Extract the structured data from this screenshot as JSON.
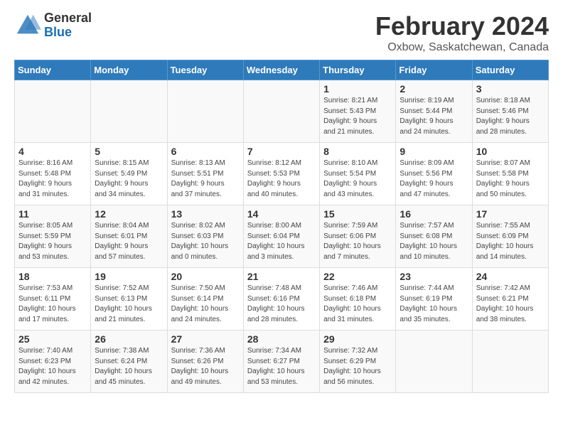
{
  "header": {
    "logo_general": "General",
    "logo_blue": "Blue",
    "month_year": "February 2024",
    "location": "Oxbow, Saskatchewan, Canada"
  },
  "days_of_week": [
    "Sunday",
    "Monday",
    "Tuesday",
    "Wednesday",
    "Thursday",
    "Friday",
    "Saturday"
  ],
  "weeks": [
    [
      {
        "day": "",
        "info": ""
      },
      {
        "day": "",
        "info": ""
      },
      {
        "day": "",
        "info": ""
      },
      {
        "day": "",
        "info": ""
      },
      {
        "day": "1",
        "info": "Sunrise: 8:21 AM\nSunset: 5:43 PM\nDaylight: 9 hours\nand 21 minutes."
      },
      {
        "day": "2",
        "info": "Sunrise: 8:19 AM\nSunset: 5:44 PM\nDaylight: 9 hours\nand 24 minutes."
      },
      {
        "day": "3",
        "info": "Sunrise: 8:18 AM\nSunset: 5:46 PM\nDaylight: 9 hours\nand 28 minutes."
      }
    ],
    [
      {
        "day": "4",
        "info": "Sunrise: 8:16 AM\nSunset: 5:48 PM\nDaylight: 9 hours\nand 31 minutes."
      },
      {
        "day": "5",
        "info": "Sunrise: 8:15 AM\nSunset: 5:49 PM\nDaylight: 9 hours\nand 34 minutes."
      },
      {
        "day": "6",
        "info": "Sunrise: 8:13 AM\nSunset: 5:51 PM\nDaylight: 9 hours\nand 37 minutes."
      },
      {
        "day": "7",
        "info": "Sunrise: 8:12 AM\nSunset: 5:53 PM\nDaylight: 9 hours\nand 40 minutes."
      },
      {
        "day": "8",
        "info": "Sunrise: 8:10 AM\nSunset: 5:54 PM\nDaylight: 9 hours\nand 43 minutes."
      },
      {
        "day": "9",
        "info": "Sunrise: 8:09 AM\nSunset: 5:56 PM\nDaylight: 9 hours\nand 47 minutes."
      },
      {
        "day": "10",
        "info": "Sunrise: 8:07 AM\nSunset: 5:58 PM\nDaylight: 9 hours\nand 50 minutes."
      }
    ],
    [
      {
        "day": "11",
        "info": "Sunrise: 8:05 AM\nSunset: 5:59 PM\nDaylight: 9 hours\nand 53 minutes."
      },
      {
        "day": "12",
        "info": "Sunrise: 8:04 AM\nSunset: 6:01 PM\nDaylight: 9 hours\nand 57 minutes."
      },
      {
        "day": "13",
        "info": "Sunrise: 8:02 AM\nSunset: 6:03 PM\nDaylight: 10 hours\nand 0 minutes."
      },
      {
        "day": "14",
        "info": "Sunrise: 8:00 AM\nSunset: 6:04 PM\nDaylight: 10 hours\nand 3 minutes."
      },
      {
        "day": "15",
        "info": "Sunrise: 7:59 AM\nSunset: 6:06 PM\nDaylight: 10 hours\nand 7 minutes."
      },
      {
        "day": "16",
        "info": "Sunrise: 7:57 AM\nSunset: 6:08 PM\nDaylight: 10 hours\nand 10 minutes."
      },
      {
        "day": "17",
        "info": "Sunrise: 7:55 AM\nSunset: 6:09 PM\nDaylight: 10 hours\nand 14 minutes."
      }
    ],
    [
      {
        "day": "18",
        "info": "Sunrise: 7:53 AM\nSunset: 6:11 PM\nDaylight: 10 hours\nand 17 minutes."
      },
      {
        "day": "19",
        "info": "Sunrise: 7:52 AM\nSunset: 6:13 PM\nDaylight: 10 hours\nand 21 minutes."
      },
      {
        "day": "20",
        "info": "Sunrise: 7:50 AM\nSunset: 6:14 PM\nDaylight: 10 hours\nand 24 minutes."
      },
      {
        "day": "21",
        "info": "Sunrise: 7:48 AM\nSunset: 6:16 PM\nDaylight: 10 hours\nand 28 minutes."
      },
      {
        "day": "22",
        "info": "Sunrise: 7:46 AM\nSunset: 6:18 PM\nDaylight: 10 hours\nand 31 minutes."
      },
      {
        "day": "23",
        "info": "Sunrise: 7:44 AM\nSunset: 6:19 PM\nDaylight: 10 hours\nand 35 minutes."
      },
      {
        "day": "24",
        "info": "Sunrise: 7:42 AM\nSunset: 6:21 PM\nDaylight: 10 hours\nand 38 minutes."
      }
    ],
    [
      {
        "day": "25",
        "info": "Sunrise: 7:40 AM\nSunset: 6:23 PM\nDaylight: 10 hours\nand 42 minutes."
      },
      {
        "day": "26",
        "info": "Sunrise: 7:38 AM\nSunset: 6:24 PM\nDaylight: 10 hours\nand 45 minutes."
      },
      {
        "day": "27",
        "info": "Sunrise: 7:36 AM\nSunset: 6:26 PM\nDaylight: 10 hours\nand 49 minutes."
      },
      {
        "day": "28",
        "info": "Sunrise: 7:34 AM\nSunset: 6:27 PM\nDaylight: 10 hours\nand 53 minutes."
      },
      {
        "day": "29",
        "info": "Sunrise: 7:32 AM\nSunset: 6:29 PM\nDaylight: 10 hours\nand 56 minutes."
      },
      {
        "day": "",
        "info": ""
      },
      {
        "day": "",
        "info": ""
      }
    ]
  ]
}
